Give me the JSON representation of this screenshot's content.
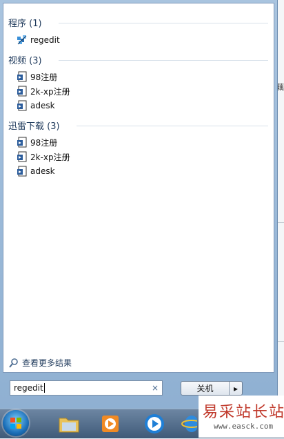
{
  "groups": [
    {
      "title": "程序 (1)",
      "items": [
        {
          "label": "regedit",
          "icon": "registry-editor-icon"
        }
      ]
    },
    {
      "title": "视频 (3)",
      "items": [
        {
          "label": "98注册",
          "icon": "video-file-icon"
        },
        {
          "label": "2k-xp注册",
          "icon": "video-file-icon"
        },
        {
          "label": "adesk",
          "icon": "video-file-icon"
        }
      ]
    },
    {
      "title": "迅雷下载 (3)",
      "items": [
        {
          "label": "98注册",
          "icon": "video-file-icon"
        },
        {
          "label": "2k-xp注册",
          "icon": "video-file-icon"
        },
        {
          "label": "adesk",
          "icon": "video-file-icon"
        }
      ]
    }
  ],
  "more_results": "查看更多结果",
  "search": {
    "value": "regedit",
    "clear": "×"
  },
  "shutdown": {
    "label": "关机",
    "arrow": "▸"
  },
  "desktop_strip_mark": "藕",
  "watermark": {
    "text": "易采站长站",
    "url": "www.easck.com"
  },
  "colors": {
    "group_title": "#1e395b",
    "accent": "#1c6fb8"
  }
}
